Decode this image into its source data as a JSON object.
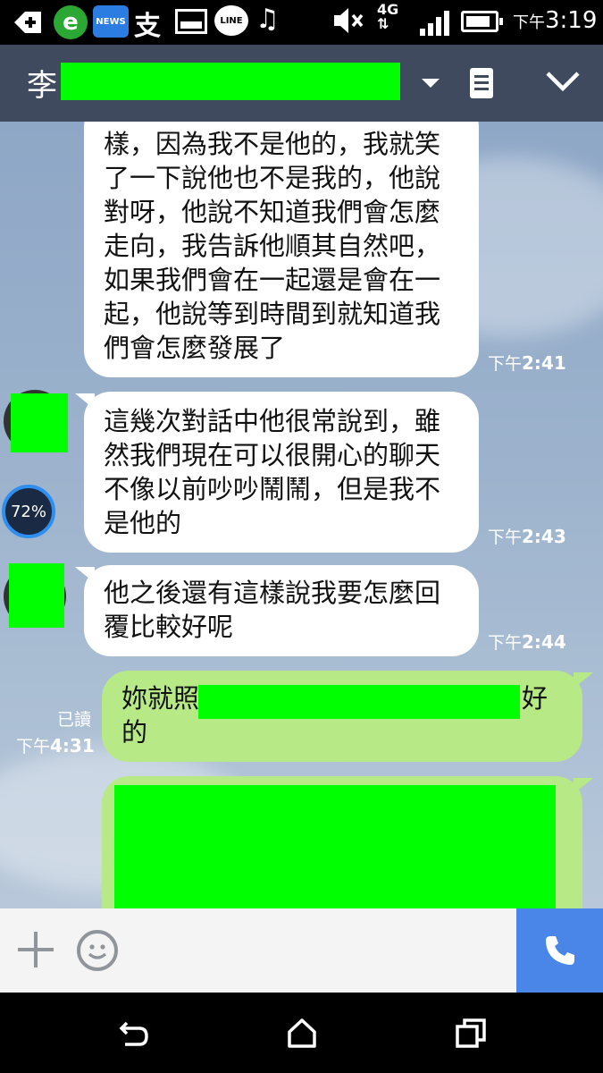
{
  "status_bar": {
    "news_badge": "NEWS",
    "line_badge": "LINE",
    "zhi_glyph": "支",
    "network": "4G",
    "clock_prefix": "下午",
    "clock_time": "3:19"
  },
  "header": {
    "contact_name": "李",
    "icons": [
      "dropdown-caret-icon",
      "notes-icon",
      "collapse-chevron-icon"
    ]
  },
  "messages": [
    {
      "sender": "other",
      "text": "樣，因為我不是他的，我就笑了一下說他也不是我的，他說對呀，他說不知道我們會怎麼走向，我告訴他順其自然吧，如果我們會在一起還是會在一起，他說等到時間到就知道我們會怎麼發展了",
      "lines": [
        "樣，因為我不是他的，我就笑",
        "了一下說他也不是我的，他說",
        "對呀，他說不知道我們會怎麼",
        "走向，我告訴他順其自然吧，",
        "如果我們會在一起還是會在一",
        "起，他說等到時間到就知道我",
        "們會怎麼發展了"
      ],
      "time_prefix": "下午",
      "time": "2:41"
    },
    {
      "sender": "other",
      "lines": [
        "這幾次對話中他很常說到，雖",
        "然我們現在可以很開心的聊天",
        "不像以前吵吵鬧鬧，但是我不",
        "是他的"
      ],
      "time_prefix": "下午",
      "time": "2:43"
    },
    {
      "sender": "other",
      "lines": [
        "他之後還有這樣說我要怎麼回",
        "覆比較好呢"
      ],
      "time_prefix": "下午",
      "time": "2:44"
    },
    {
      "sender": "me",
      "line1_start": "妳就照",
      "line1_end": "好",
      "line2": "的",
      "read_label": "已讀",
      "time_prefix": "下午",
      "time": "4:31"
    }
  ],
  "overlay": {
    "meter_value": "72%"
  },
  "input_bar": {
    "icons": [
      "plus-icon",
      "emoji-icon",
      "phone-icon"
    ]
  },
  "nav_bar": {
    "icons": [
      "back-icon",
      "home-icon",
      "recents-icon"
    ]
  },
  "colors": {
    "header_bg": "#3f4a5e",
    "bubble_other": "#ffffff",
    "bubble_me": "#b7ea86",
    "redaction": "#00ff00",
    "call_button": "#4a86e8"
  }
}
